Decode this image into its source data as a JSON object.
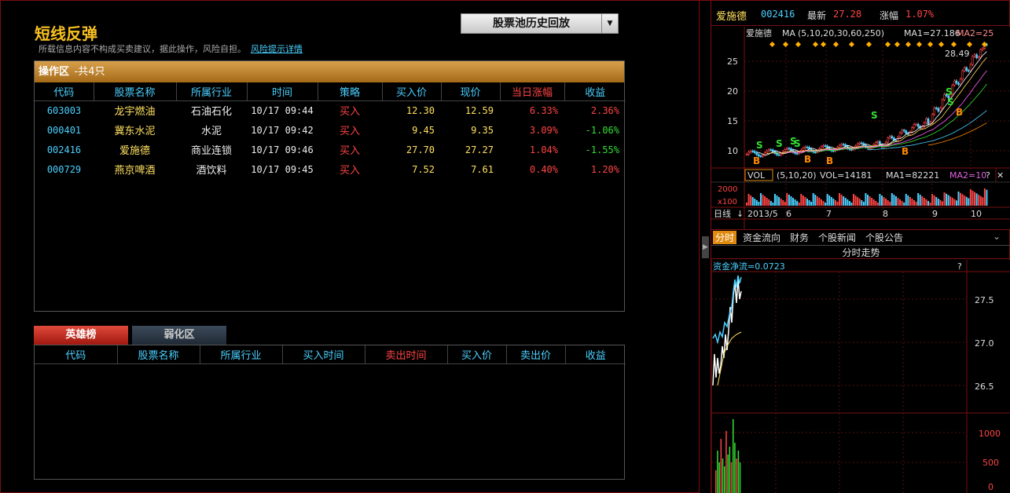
{
  "page": {
    "title": "短线反弹",
    "disclaimer": "所载信息内容不构成买卖建议，据此操作，风险自担。",
    "risk_link": "风险提示详情",
    "replay_button": "股票池历史回放"
  },
  "ops": {
    "header_label": "操作区",
    "header_count": "-共4只",
    "columns": [
      "代码",
      "股票名称",
      "所属行业",
      "时间",
      "策略",
      "买入价",
      "现价",
      "当日涨幅",
      "收益"
    ],
    "rows": [
      {
        "code": "603003",
        "name": "龙宇燃油",
        "industry": "石油石化",
        "time": "10/17 09:44",
        "strategy": "买入",
        "buy": "12.30",
        "now": "12.59",
        "chg": "6.33%",
        "profit": "2.36%",
        "profit_up": true
      },
      {
        "code": "000401",
        "name": "冀东水泥",
        "industry": "水泥",
        "time": "10/17 09:42",
        "strategy": "买入",
        "buy": "9.45",
        "now": "9.35",
        "chg": "3.09%",
        "profit": "-1.06%",
        "profit_up": false
      },
      {
        "code": "002416",
        "name": "爱施德",
        "industry": "商业连锁",
        "time": "10/17 09:46",
        "strategy": "买入",
        "buy": "27.70",
        "now": "27.27",
        "chg": "1.04%",
        "profit": "-1.55%",
        "profit_up": false
      },
      {
        "code": "000729",
        "name": "燕京啤酒",
        "industry": "酒饮料",
        "time": "10/17 09:45",
        "strategy": "买入",
        "buy": "7.52",
        "now": "7.61",
        "chg": "0.40%",
        "profit": "1.20%",
        "profit_up": true
      }
    ]
  },
  "tabs2": {
    "active": "英雄榜",
    "inactive": "弱化区"
  },
  "hero": {
    "columns": [
      "代码",
      "股票名称",
      "所属行业",
      "买入时间",
      "卖出时间",
      "买入价",
      "卖出价",
      "收益"
    ]
  },
  "quote": {
    "name": "爱施德",
    "code": "002416",
    "last_label": "最新",
    "last": "27.28",
    "chg_label": "涨幅",
    "chg": "1.07%"
  },
  "kline": {
    "legend_name": "爱施德",
    "ma_label": "MA",
    "ma_periods": "(5,10,20,30,60,250)",
    "ma1": "MA1=27.186",
    "ma2": "MA2=25",
    "peak_label": "28.49",
    "y_ticks": [
      "25",
      "20",
      "15",
      "10"
    ],
    "vol_label": "VOL",
    "vol_periods": "(5,10,20)",
    "vol_value": "VOL=14181",
    "vol_ma1": "MA1=82221",
    "vol_ma2": "MA2=10",
    "vol_ticks": [
      "2000",
      "x100"
    ],
    "period_label": "日线",
    "x_ticks": [
      "2013/5",
      "6",
      "7",
      "8",
      "9",
      "10"
    ]
  },
  "fenshi": {
    "tabs": [
      "分时",
      "资金流向",
      "财务",
      "个股新闻",
      "个股公告"
    ],
    "title": "分时走势",
    "flow": "资金净流=0.0723",
    "help": "?",
    "y_ticks": [
      "27.5",
      "27.0",
      "26.5"
    ],
    "vol_ticks": [
      "1000",
      "500",
      "0"
    ]
  },
  "colors": {
    "accent": "#f8c020",
    "up": "#ff4444",
    "down": "#32e032",
    "cyan": "#4ad0ff"
  }
}
